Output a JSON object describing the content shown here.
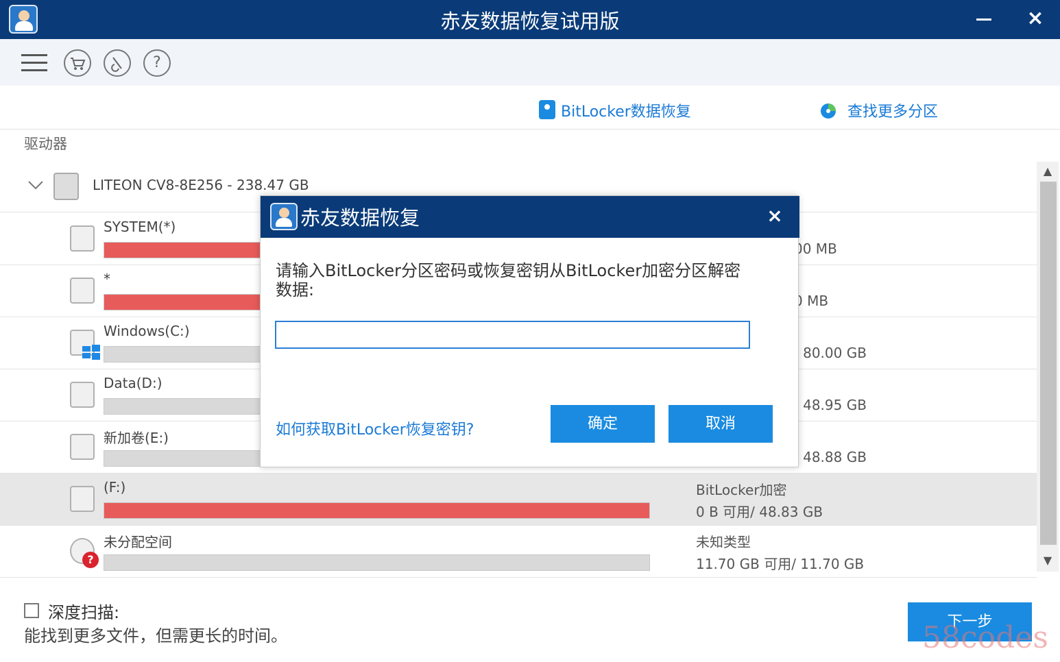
{
  "window": {
    "title": "赤友数据恢复试用版",
    "minimize_label": "–",
    "close_label": "×"
  },
  "toolbar": {
    "buttons": [
      {
        "name": "menu-icon",
        "glyph": "≡"
      },
      {
        "name": "cart-icon",
        "glyph": "🛒"
      },
      {
        "name": "tool-icon",
        "glyph": "⚙"
      },
      {
        "name": "help-icon",
        "glyph": "?"
      }
    ]
  },
  "top_links": {
    "bitlocker": "BitLocker数据恢复",
    "find_partitions": "查找更多分区"
  },
  "drives": {
    "label": "驱动器",
    "disk": "LITEON CV8-8E256    - 238.47 GB",
    "partitions": [
      {
        "name": "SYSTEM(*)",
        "fill_percent": 100,
        "fill_color": "#e85b5b",
        "info1": "",
        "info2": "00 MB"
      },
      {
        "name": "*",
        "fill_percent": 100,
        "fill_color": "#e85b5b",
        "info1": "",
        "info2": "0 MB"
      },
      {
        "name": "Windows(C:)",
        "fill_percent": 90,
        "fill_color": "#d9d9d9",
        "info1": "",
        "info2": "/ 80.00 GB"
      },
      {
        "name": "Data(D:)",
        "fill_percent": 90,
        "fill_color": "#d9d9d9",
        "info1": "",
        "info2": "/ 48.95 GB"
      },
      {
        "name": "新加卷(E:)",
        "fill_percent": 2,
        "fill_color": "#d9d9d9",
        "info1": "",
        "info2": "/ 48.88 GB"
      },
      {
        "name": "(F:)",
        "fill_percent": 100,
        "fill_color": "#e85b5b",
        "info1": "BitLocker加密",
        "info2": "0 B 可用/ 48.83 GB"
      },
      {
        "name": "未分配空间",
        "fill_percent": 0,
        "fill_color": "#d9d9d9",
        "info1": "未知类型",
        "info2": "11.70 GB 可用/ 11.70 GB"
      }
    ]
  },
  "deep_scan": {
    "title": "深度扫描:",
    "desc": "能找到更多文件，但需更长的时间。"
  },
  "next_button": "下一步",
  "watermark": "58codes",
  "dialog": {
    "title": "赤友数据恢复",
    "prompt": "请输入BitLocker分区密码或恢复密钥从BitLocker加密分区解密数据:",
    "input_value": "",
    "help_link": "如何获取BitLocker恢复密钥?",
    "ok": "确定",
    "cancel": "取消",
    "close": "×"
  },
  "colors": {
    "titlebar": "#0a3b78",
    "accent": "#1a8be0",
    "bar_red": "#e85b5b"
  }
}
